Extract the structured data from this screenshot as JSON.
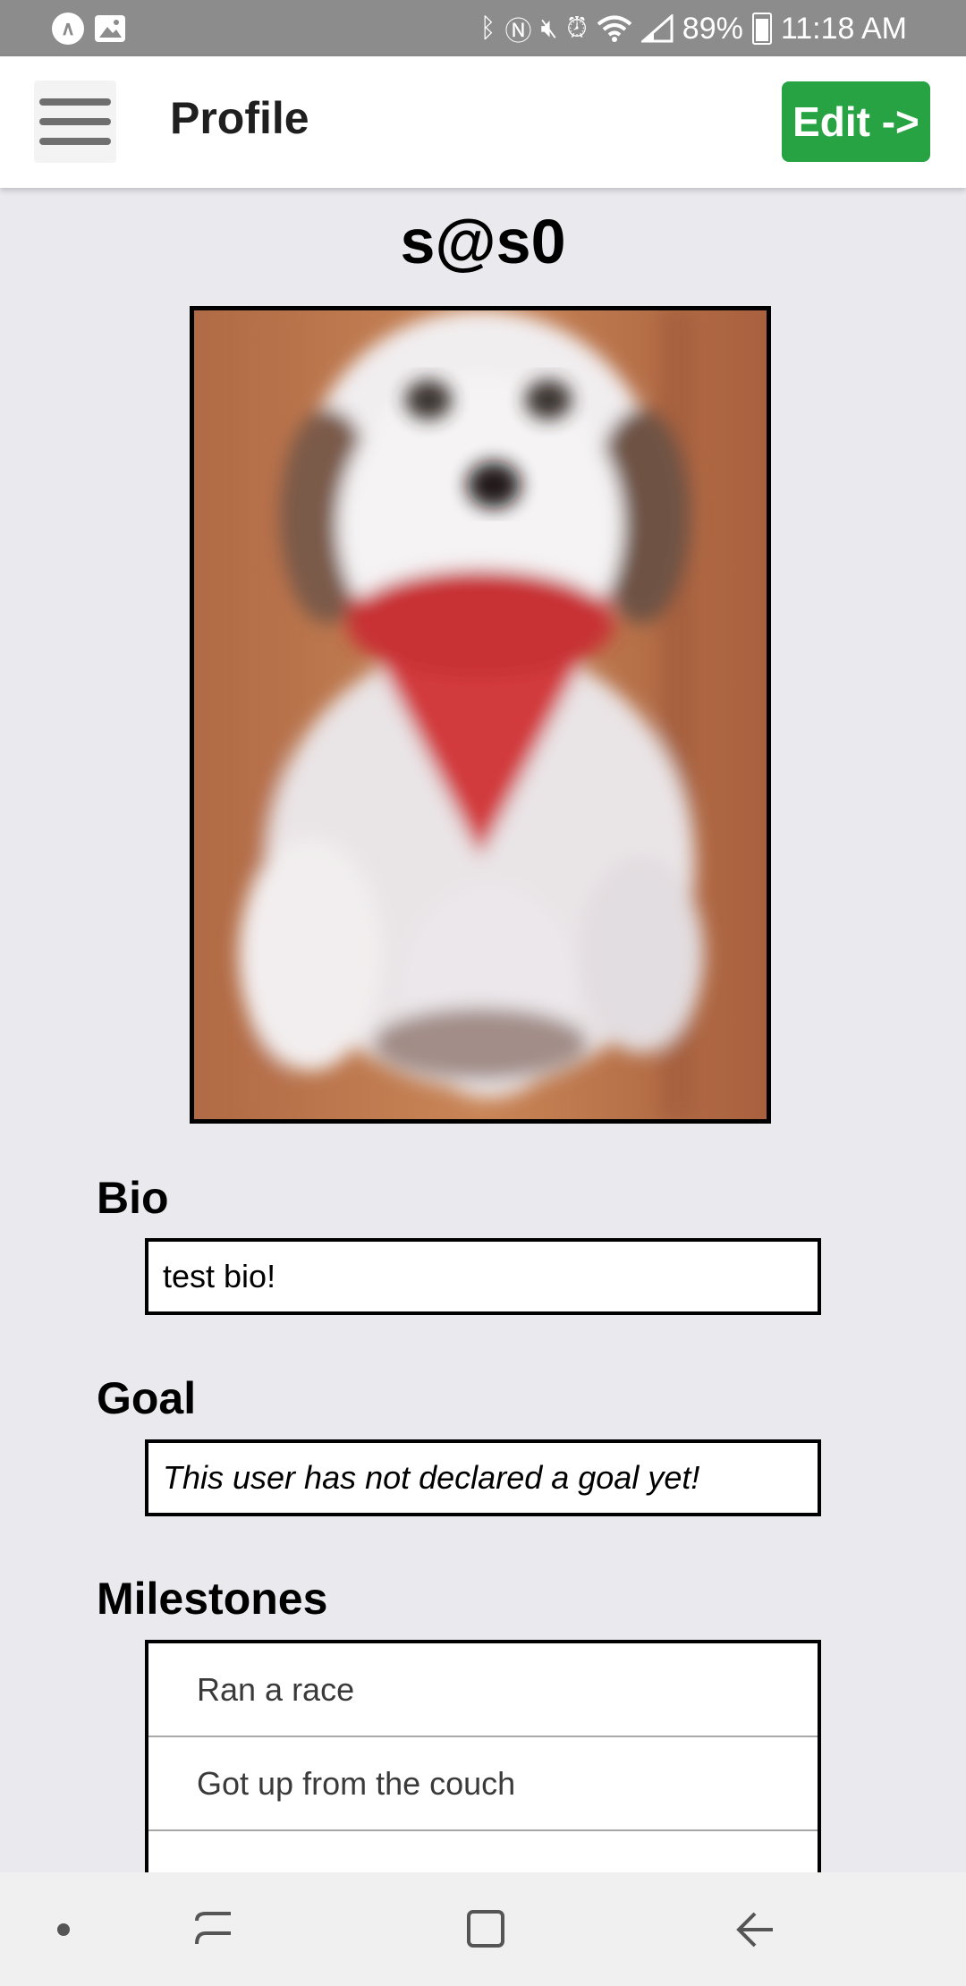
{
  "status_bar": {
    "battery": "89%",
    "time": "11:18 AM",
    "left_icons": [
      "android-auto-icon",
      "image-icon"
    ],
    "right_icons": [
      "bluetooth-icon",
      "nfc-icon",
      "mute-icon",
      "alarm-icon",
      "wifi-icon",
      "signal-icon",
      "battery-icon"
    ]
  },
  "header": {
    "title": "Profile",
    "edit_label": "Edit ->",
    "edit_color": "#27a344"
  },
  "profile": {
    "username": "s@s0",
    "bio_label": "Bio",
    "bio_value": "test bio!",
    "goal_label": "Goal",
    "goal_value": "This user has not declared a goal yet!",
    "milestones_label": "Milestones",
    "milestones": [
      {
        "label": "Ran a race"
      },
      {
        "label": "Got up from the couch"
      },
      {
        "label": ""
      }
    ]
  },
  "nav_bar": {
    "icons": [
      "dot-icon",
      "recent-apps-icon",
      "home-icon",
      "back-icon"
    ]
  }
}
